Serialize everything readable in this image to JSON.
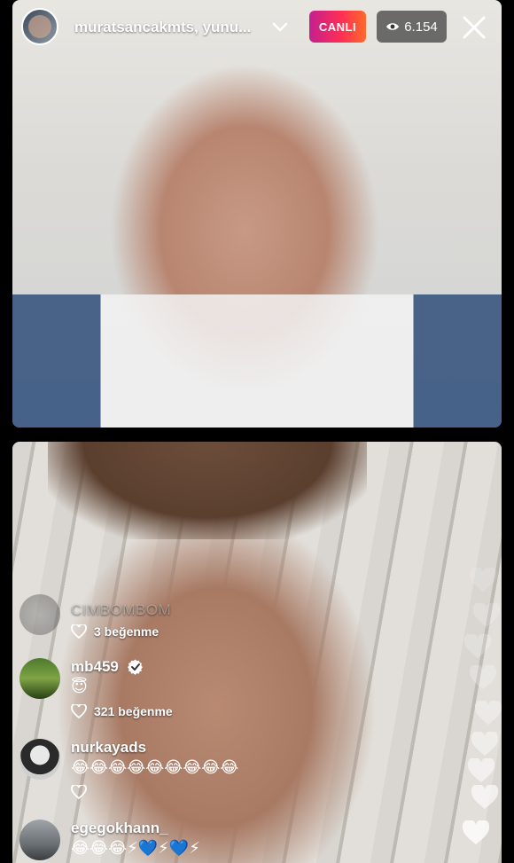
{
  "header": {
    "host_names": "muratsancakmts, yunu...",
    "live_label": "CANLI",
    "viewer_count": "6.154"
  },
  "comments": [
    {
      "username": "CIMBOMBOM",
      "text": "",
      "likes": "3 beğenme",
      "faded": true
    },
    {
      "username": "mb459",
      "verified": true,
      "text": "😇",
      "likes": "321 beğenme"
    },
    {
      "username": "nurkayads",
      "text": "😂😂😂😂😂😂😂😂😂",
      "likes": ""
    },
    {
      "username": "egegokhann_",
      "text": "😂😂😂⚡💙⚡💙⚡",
      "likes": ""
    }
  ],
  "colors": {
    "live_gradient_start": "#c3208f",
    "live_gradient_end": "#ff6a2b"
  }
}
